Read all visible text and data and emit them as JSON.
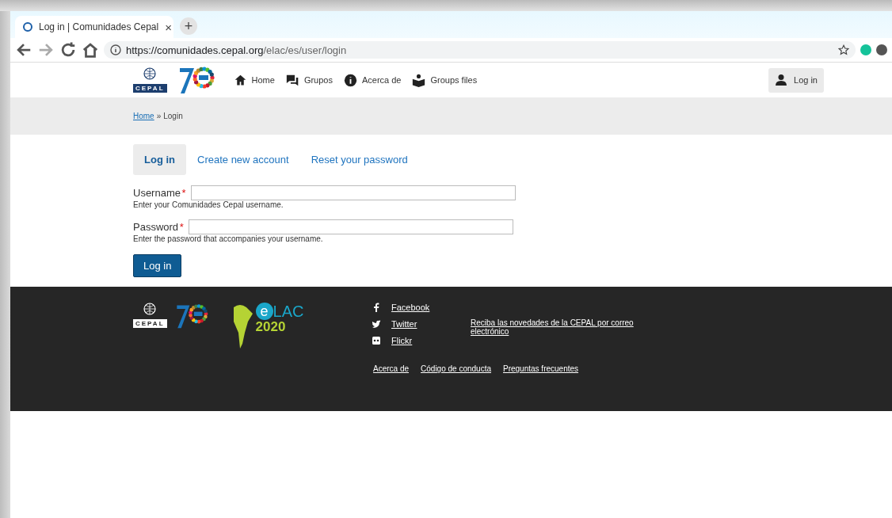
{
  "browser": {
    "tab_title": "Log in | Comunidades Cepal",
    "tab_close": "×",
    "new_tab": "+",
    "url_host": "https://comunidades.cepal.org",
    "url_path": "/elac/es/user/login"
  },
  "header": {
    "logo_text": "CEPAL",
    "nav": [
      {
        "label": "Home",
        "kind": "home"
      },
      {
        "label": "Grupos",
        "kind": "chat"
      },
      {
        "label": "Acerca de",
        "kind": "info"
      },
      {
        "label": "Groups files",
        "kind": "reader"
      }
    ],
    "login_button": "Log in"
  },
  "breadcrumb": {
    "link": "Home",
    "separator": "»",
    "current": "Login"
  },
  "tabs": [
    {
      "label": "Log in",
      "selected": true
    },
    {
      "label": "Create new account",
      "selected": false
    },
    {
      "label": "Reset your password",
      "selected": false
    }
  ],
  "form": {
    "fields": [
      {
        "label": "Username",
        "required_mark": "*",
        "description": "Enter your Comunidades Cepal username."
      },
      {
        "label": "Password",
        "required_mark": "*",
        "description": "Enter the password that accompanies your username."
      }
    ],
    "submit": "Log in"
  },
  "footer": {
    "logo_text": "CEPAL",
    "elac": {
      "letter": "e",
      "word": "LAC",
      "year": "2020"
    },
    "social": [
      {
        "label": "Facebook",
        "kind": "facebook"
      },
      {
        "label": "Twitter",
        "kind": "twitter"
      },
      {
        "label": "Flickr",
        "kind": "flickr"
      }
    ],
    "newsletter": "Reciba las novedades de la CEPAL por correo electrónico",
    "links": [
      "Acerca de",
      "Código de conducta",
      "Preguntas frecuentes"
    ]
  }
}
